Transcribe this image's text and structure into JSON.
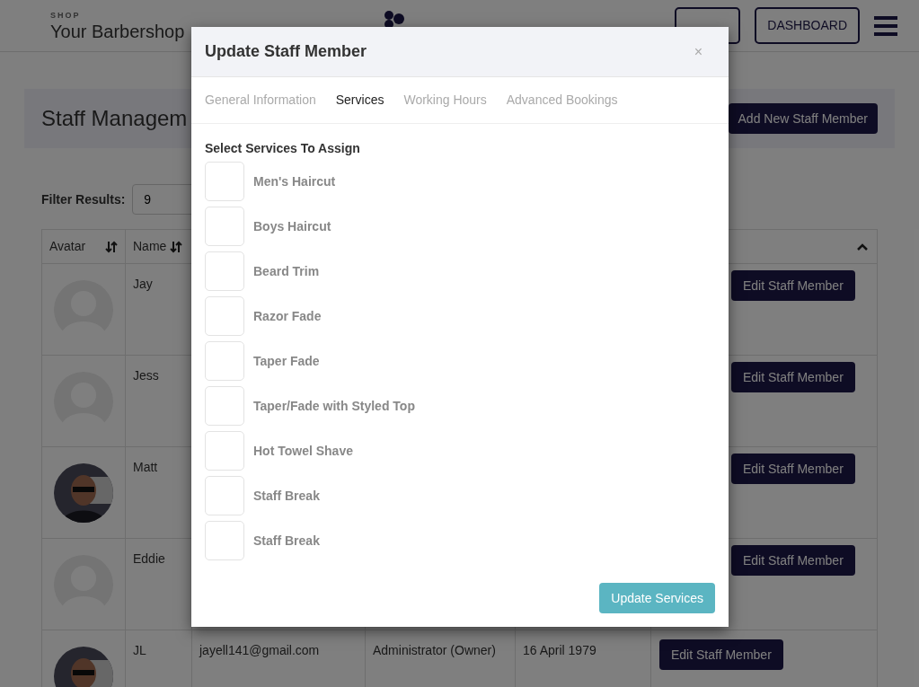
{
  "header": {
    "shop_label": "SHOP",
    "shop_name": "Your Barbershop",
    "buttons": [
      {
        "kind": "covered"
      },
      {
        "kind": "label",
        "label": "DASHBOARD"
      }
    ]
  },
  "page": {
    "title": "Staff Managem",
    "add_button": "Add New Staff Member",
    "filter_label": "Filter Results:",
    "filter_value": "9"
  },
  "table": {
    "columns": [
      "Avatar",
      "Name"
    ],
    "rows": [
      {
        "kind": "default",
        "name": "Jay",
        "action": "Edit Staff Member"
      },
      {
        "kind": "default",
        "name": "Jess",
        "action": "Edit Staff Member"
      },
      {
        "name": "Matt",
        "action": "Edit Staff Member"
      },
      {
        "kind": "default",
        "name": "Eddie",
        "action": "Edit Staff Member"
      },
      {
        "name": "JL",
        "email": "jayell141@gmail.com",
        "role": "Administrator (Owner)",
        "dob": "16 April 1979",
        "action": "Edit Staff Member"
      }
    ]
  },
  "modal": {
    "title": "Update Staff Member",
    "close": "×",
    "tabs": [
      {
        "label": "General Information",
        "selected": false
      },
      {
        "label": "Services",
        "selected": true
      },
      {
        "label": "Working Hours",
        "selected": false
      },
      {
        "label": "Advanced Bookings",
        "selected": false
      }
    ],
    "section_title": "Select Services To Assign",
    "services": [
      {
        "label": "Men's Haircut",
        "checked": false
      },
      {
        "label": "Boys Haircut",
        "checked": false
      },
      {
        "label": "Beard Trim",
        "checked": false
      },
      {
        "label": "Razor Fade",
        "checked": false
      },
      {
        "label": "Taper Fade",
        "checked": false
      },
      {
        "label": "Taper/Fade with Styled Top",
        "checked": false
      },
      {
        "label": "Hot Towel Shave",
        "checked": false
      },
      {
        "label": "Staff Break",
        "checked": false
      },
      {
        "label": "Staff Break",
        "checked": false
      }
    ],
    "submit": "Update Services"
  }
}
